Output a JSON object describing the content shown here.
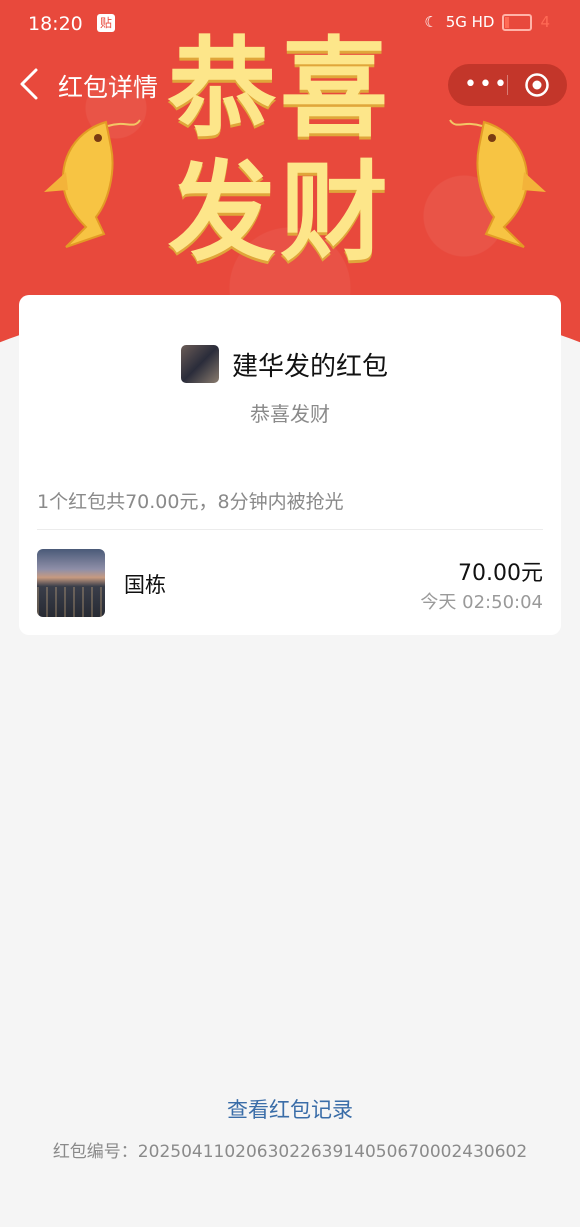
{
  "status_bar": {
    "time": "18:20",
    "app_badge": "贴",
    "network": "5G HD",
    "battery_level": "4"
  },
  "nav": {
    "title": "红包详情",
    "menu_glyph": "•••"
  },
  "banner": {
    "line1": "恭喜",
    "line2": "发财"
  },
  "packet": {
    "sender_title": "建华发的红包",
    "wish": "恭喜发财",
    "summary": "1个红包共70.00元，8分钟内被抢光"
  },
  "receivers": [
    {
      "name": "国栋",
      "amount": "70.00元",
      "time": "今天 02:50:04"
    }
  ],
  "footer": {
    "records_link": "查看红包记录",
    "serial": "红包编号：20250411020630226391405067000243060​2"
  },
  "colors": {
    "banner_red": "#e8493c",
    "gold": "#fde68a",
    "link_blue": "#3a6da8"
  }
}
